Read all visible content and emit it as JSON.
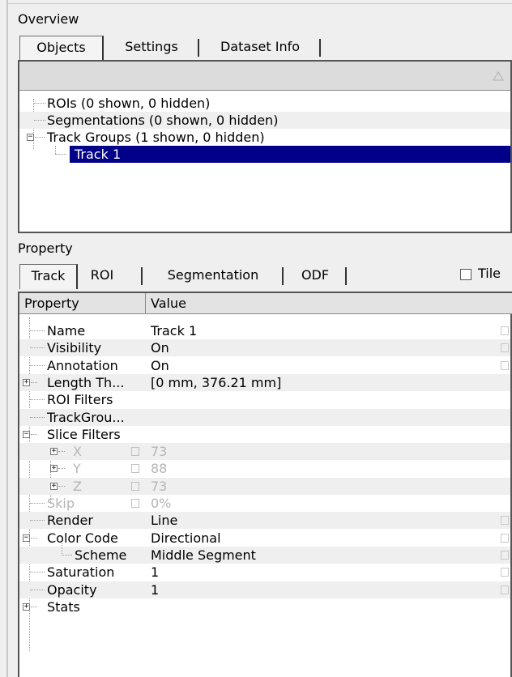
{
  "overview": {
    "title": "Overview",
    "tabs": [
      "Objects",
      "Settings",
      "Dataset Info"
    ],
    "tree": [
      {
        "label": "ROIs (0 shown, 0 hidden)"
      },
      {
        "label": "Segmentations (0 shown, 0 hidden)"
      },
      {
        "label": "Track Groups (1 shown, 0 hidden)"
      },
      {
        "label": "Track 1"
      }
    ]
  },
  "property": {
    "title": "Property",
    "tabs": [
      "Track",
      "ROI",
      "Segmentation",
      "ODF"
    ],
    "tile_label": "Tile",
    "col_property": "Property",
    "col_value": "Value",
    "rows": [
      {
        "name": "Name",
        "value": "Track 1"
      },
      {
        "name": "Visibility",
        "value": "On"
      },
      {
        "name": "Annotation",
        "value": "On"
      },
      {
        "name": "Length Th...",
        "value": "[0 mm,  376.21 mm]"
      },
      {
        "name": "ROI Filters",
        "value": ""
      },
      {
        "name": "TrackGrou...",
        "value": ""
      },
      {
        "name": "Slice Filters",
        "value": ""
      },
      {
        "name": "X",
        "value": "73"
      },
      {
        "name": "Y",
        "value": "88"
      },
      {
        "name": "Z",
        "value": "73"
      },
      {
        "name": "Skip",
        "value": "0%"
      },
      {
        "name": "Render",
        "value": "Line"
      },
      {
        "name": "Color Code",
        "value": "Directional"
      },
      {
        "name": "Scheme",
        "value": "Middle Segment"
      },
      {
        "name": "Saturation",
        "value": "1"
      },
      {
        "name": "Opacity",
        "value": "1"
      },
      {
        "name": "Stats",
        "value": ""
      }
    ]
  },
  "icons": {
    "expander_plus": "plus-box-icon",
    "expander_minus": "minus-box-icon",
    "edit": "edit-field-icon",
    "sort": "sort-triangle-icon"
  }
}
